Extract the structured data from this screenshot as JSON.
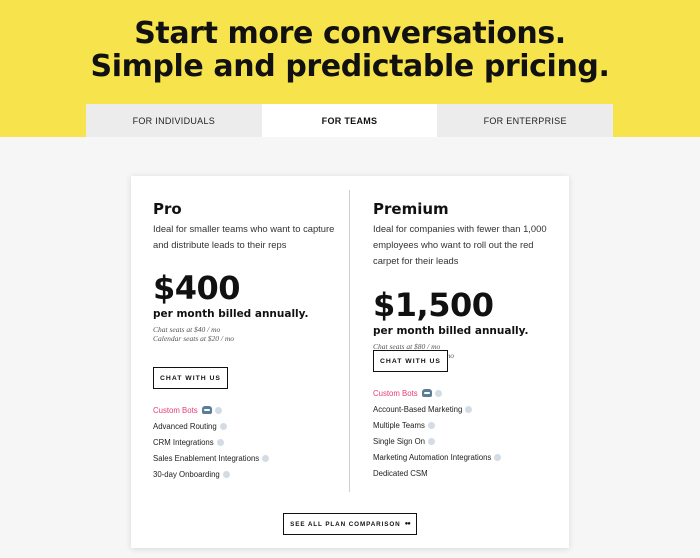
{
  "hero": {
    "title_line1": "Start more conversations.",
    "title_line2": "Simple and predictable pricing.",
    "background_color": "#f7e34b"
  },
  "tabs": [
    {
      "label": "FOR INDIVIDUALS",
      "active": false
    },
    {
      "label": "FOR TEAMS",
      "active": true
    },
    {
      "label": "FOR ENTERPRISE",
      "active": false
    }
  ],
  "plans": {
    "pro": {
      "name": "Pro",
      "description": "Ideal for smaller teams who want to capture and distribute leads to their reps",
      "price": "$400",
      "billing": "per month billed annually.",
      "seat_chat": "Chat seats at $40 / mo",
      "seat_calendar": "Calendar seats at $20 / mo",
      "button_label": "CHAT WITH US",
      "features": [
        "Custom Bots",
        "Advanced Routing",
        "CRM Integrations",
        "Sales Enablement Integrations",
        "30-day Onboarding"
      ]
    },
    "premium": {
      "name": "Premium",
      "description": "Ideal for companies with fewer than 1,000 employees who want to roll out the red carpet for their leads",
      "price": "$1,500",
      "billing": "per month billed annually.",
      "seat_chat": "Chat seats at $80 / mo",
      "seat_calendar": "Calendar seats at $20 / mo",
      "button_label": "CHAT WITH US",
      "features": [
        "Custom Bots",
        "Account-Based Marketing",
        "Multiple Teams",
        "Single Sign On",
        "Marketing Automation Integrations",
        "Dedicated CSM"
      ]
    }
  },
  "compare_button": {
    "label": "SEE ALL PLAN COMPARISON",
    "icon": "eyes-icon"
  },
  "colors": {
    "accent_pink": "#e63b7a",
    "text": "#111111"
  }
}
